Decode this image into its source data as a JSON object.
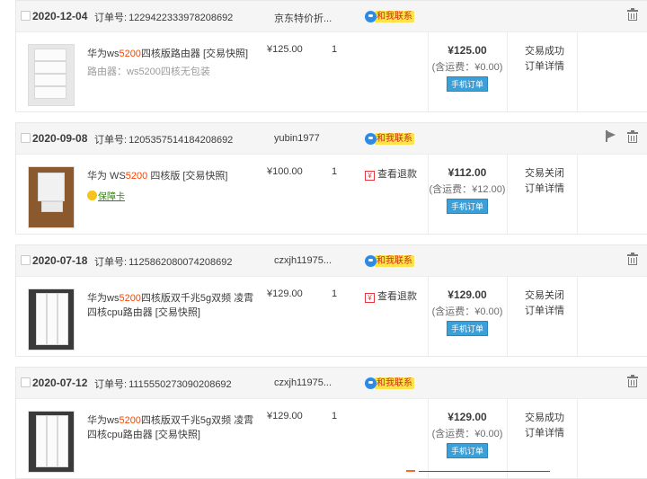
{
  "orders": [
    {
      "date": "2020-12-04",
      "order_label": "订单号:",
      "order_no": "1229422333978208692",
      "shop": "京东特价折...",
      "contact": "和我联系",
      "title_pre": "华为ws",
      "title_hl": "5200",
      "title_post": "四核版路由器 [交易快照]",
      "sub": "路由器：ws5200四核无包装",
      "price": "¥125.00",
      "qty": "1",
      "total": "¥125.00",
      "shipping": "(含运费：¥0.00)",
      "mobile": "手机订单",
      "status": "交易成功",
      "detail": "订单详情"
    },
    {
      "date": "2020-09-08",
      "order_label": "订单号:",
      "order_no": "1205357514184208692",
      "shop": "yubin1977",
      "contact": "和我联系",
      "title_pre": "华为 WS",
      "title_hl": "5200",
      "title_post": " 四核版 [交易快照]",
      "badge": "保障卡",
      "price": "¥100.00",
      "qty": "1",
      "refund": "查看退款",
      "total": "¥112.00",
      "shipping": "(含运费：¥12.00)",
      "mobile": "手机订单",
      "status": "交易关闭",
      "detail": "订单详情"
    },
    {
      "date": "2020-07-18",
      "order_label": "订单号:",
      "order_no": "1125862080074208692",
      "shop": "czxjh11975...",
      "contact": "和我联系",
      "title_pre": "华为ws",
      "title_hl": "5200",
      "title_post": "四核版双千兆5g双频 凌霄四核cpu路由器 [交易快照]",
      "price": "¥129.00",
      "qty": "1",
      "refund": "查看退款",
      "total": "¥129.00",
      "shipping": "(含运费：¥0.00)",
      "mobile": "手机订单",
      "status": "交易关闭",
      "detail": "订单详情"
    },
    {
      "date": "2020-07-12",
      "order_label": "订单号:",
      "order_no": "1115550273090208692",
      "shop": "czxjh11975...",
      "contact": "和我联系",
      "title_pre": "华为ws",
      "title_hl": "5200",
      "title_post": "四核版双千兆5g双频 凌霄四核cpu路由器 [交易快照]",
      "price": "¥129.00",
      "qty": "1",
      "total": "¥129.00",
      "shipping": "(含运费：¥0.00)",
      "mobile": "手机订单",
      "status": "交易成功",
      "detail": "订单详情"
    }
  ],
  "icons": {
    "contact": "chat-bubble-icon",
    "delete": "trash-icon",
    "flag": "flag-icon",
    "refund": "refund-icon",
    "badge": "warranty-icon"
  },
  "colors": {
    "highlight": "#ff4400",
    "mobile_badge": "#3b9fd8",
    "contact_tag": "#fde24a"
  }
}
